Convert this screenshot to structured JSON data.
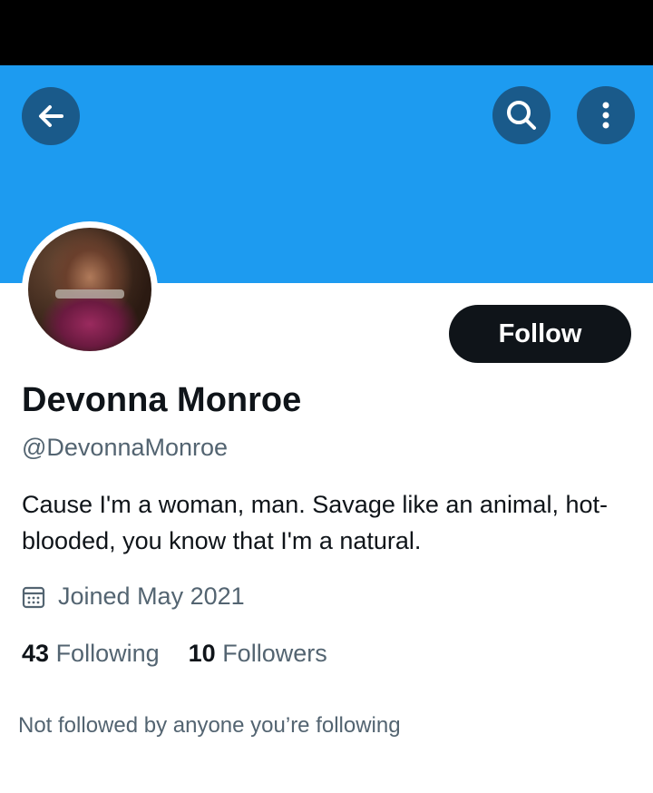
{
  "header": {
    "back_icon": "arrow-left-icon",
    "search_icon": "search-icon",
    "more_icon": "more-vertical-icon",
    "banner_color": "#1d9bf0"
  },
  "profile": {
    "name": "Devonna Monroe",
    "handle": "@DevonnaMonroe",
    "bio": "Cause I'm a woman, man. Savage like an animal, hot-blooded, you know that I'm a natural.",
    "joined": "Joined May 2021",
    "following_count": "43",
    "following_label": "Following",
    "followers_count": "10",
    "followers_label": "Followers",
    "mutuals_note": "Not followed by anyone you’re following"
  },
  "actions": {
    "follow_label": "Follow"
  }
}
